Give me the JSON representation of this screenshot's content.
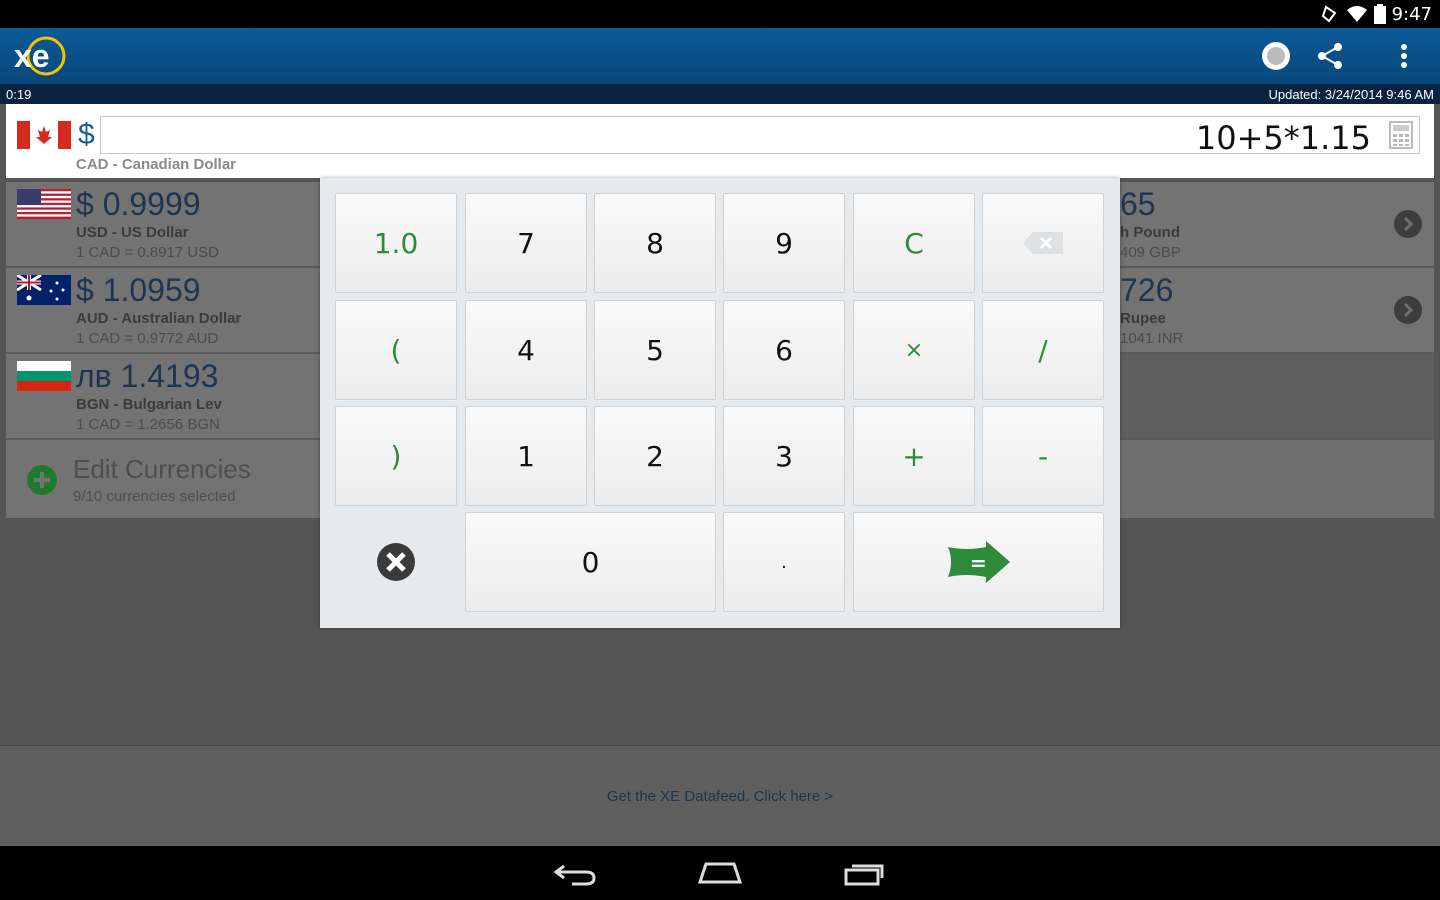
{
  "status": {
    "time": "9:47"
  },
  "appbar": {
    "logo_text": "xe",
    "refresh_icon": "refresh-icon",
    "share_icon": "share-icon",
    "menu_icon": "overflow-menu-icon"
  },
  "subbar": {
    "timer": "0:19",
    "updated": "Updated:  3/24/2014 9:46 AM"
  },
  "base": {
    "symbol": "$",
    "value": "10+5*1.15",
    "name": "CAD - Canadian Dollar"
  },
  "rows_left": [
    {
      "amount": "$ 0.9999",
      "name": "USD - US Dollar",
      "rate": "1 CAD = 0.8917 USD"
    },
    {
      "amount": "$ 1.0959",
      "name": "AUD - Australian Dollar",
      "rate": "1 CAD = 0.9772 AUD"
    },
    {
      "amount": "лв 1.4193",
      "name": "BGN - Bulgarian Lev",
      "rate": "1 CAD = 1.2656 BGN"
    }
  ],
  "rows_right": [
    {
      "amount": "65",
      "name": "h Pound",
      "rate": "409 GBP"
    },
    {
      "amount": "726",
      "name": " Rupee",
      "rate": "1041 INR"
    }
  ],
  "edit": {
    "title": "Edit Currencies",
    "subtitle": "9/10 currencies selected"
  },
  "keys": {
    "k10": "1.0",
    "k7": "7",
    "k8": "8",
    "k9": "9",
    "kc": "C",
    "kopen": "(",
    "k4": "4",
    "k5": "5",
    "k6": "6",
    "kmul": "×",
    "kdiv": "/",
    "kclose": ")",
    "k1": "1",
    "k2": "2",
    "k3": "3",
    "kplus": "+",
    "kminus": "-",
    "k0": "0",
    "kdot": ".",
    "kequals": "="
  },
  "banner": {
    "text": "Get the XE Datafeed. Click here >"
  },
  "colors": {
    "accent_green": "#2e8b3a",
    "appbar_blue": "#0d5a97",
    "amount_blue": "#1d3550"
  }
}
